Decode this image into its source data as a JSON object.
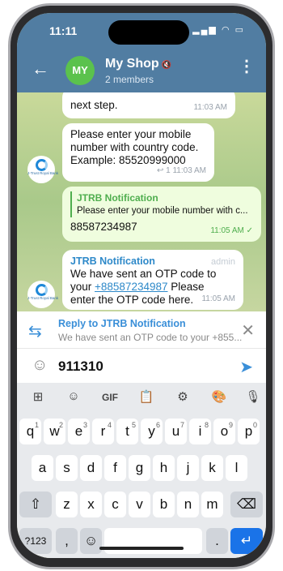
{
  "status": {
    "time": "11:11",
    "icons": "▂▄▆ ◠ ▭"
  },
  "header": {
    "back_icon": "←",
    "avatar_initials": "MY",
    "title": "My Shop",
    "mute_icon": "🔇",
    "subtitle": "2 members",
    "menu_icon": "⋮",
    "bg_color": "#517da2"
  },
  "messages": [
    {
      "text": "next step.",
      "time": "11:03 AM"
    },
    {
      "text": "Please enter your mobile number with country code. Example: 85520999000",
      "meta": "↩ 1 11:03 AM",
      "avatar_label": "J-Trust Royal Bank"
    },
    {
      "quote_title": "JTRB Notification",
      "quote_text": "Please enter your mobile number with c...",
      "text": "88587234987",
      "time": "11:05 AM ✓"
    },
    {
      "sender": "JTRB Notification",
      "tag": "admin",
      "text_before": "We have sent an OTP code to your ",
      "link": "+88587234987",
      "text_after": " Please enter the OTP code here.",
      "time": "11:05 AM",
      "avatar_label": "J-Trust Royal Bank"
    }
  ],
  "reply": {
    "icon": "⇆",
    "title": "Reply to JTRB Notification",
    "text": "We have sent an OTP code to your +855...",
    "close_icon": "✕"
  },
  "composer": {
    "emoji_icon": "☺",
    "value": "911310",
    "send_icon": "➤"
  },
  "keyboard": {
    "toolbar": [
      "⊞",
      "☺",
      "GIF",
      "📋",
      "⚙",
      "🎨",
      "🎙"
    ],
    "row1": [
      "q",
      "w",
      "e",
      "r",
      "t",
      "y",
      "u",
      "i",
      "o",
      "p"
    ],
    "row1_hints": [
      "1",
      "2",
      "3",
      "4",
      "5",
      "6",
      "7",
      "8",
      "9",
      "0"
    ],
    "row2": [
      "a",
      "s",
      "d",
      "f",
      "g",
      "h",
      "j",
      "k",
      "l"
    ],
    "row3": [
      "z",
      "x",
      "c",
      "v",
      "b",
      "n",
      "m"
    ],
    "shift": "⇧",
    "backspace": "⌫",
    "numbers": "?123",
    "comma": ",",
    "emoji": "☺",
    "period": ".",
    "enter": "↵"
  },
  "colors": {
    "accent": "#3a8fd8",
    "outgoing": "#effdde",
    "enter": "#1a73e8"
  }
}
